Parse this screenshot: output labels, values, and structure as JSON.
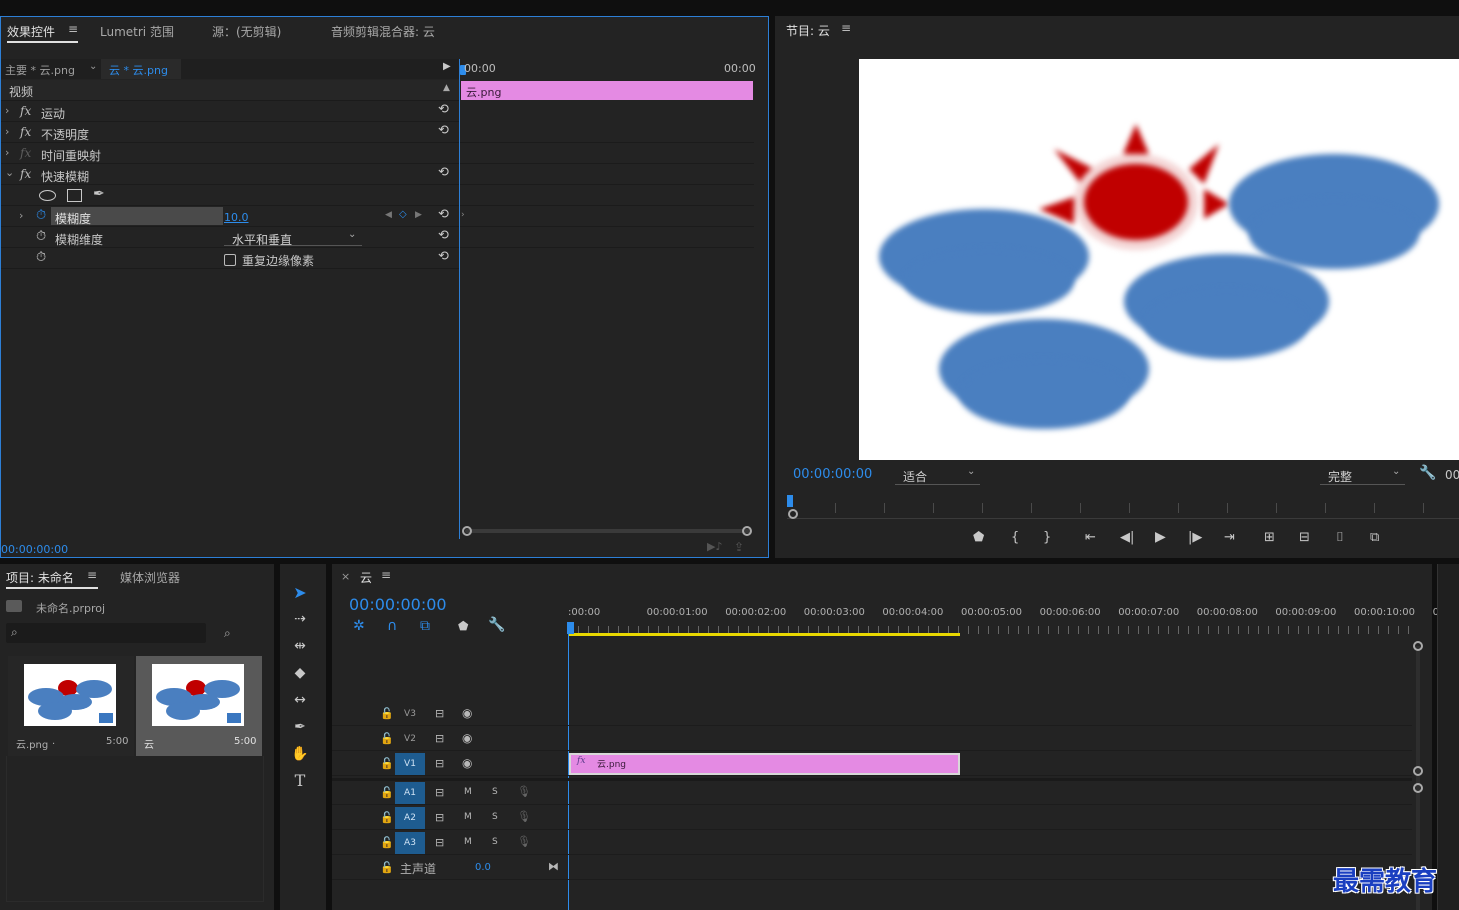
{
  "effect_controls": {
    "tabs": [
      "效果控件",
      "Lumetri 范围",
      "源：(无剪辑)",
      "音频剪辑混合器: 云"
    ],
    "menu_icon": "hamburger-icon",
    "breadcrumb_master": "主要 * 云.png",
    "breadcrumb_clip": "云 * 云.png",
    "section_video": "视频",
    "effects": [
      {
        "name": "运动",
        "fx_enabled": true
      },
      {
        "name": "不透明度",
        "fx_enabled": true
      },
      {
        "name": "时间重映射",
        "fx_enabled": false
      },
      {
        "name": "快速模糊",
        "fx_enabled": true
      }
    ],
    "params": {
      "blurriness_label": "模糊度",
      "blurriness_value": "10.0",
      "dimension_label": "模糊维度",
      "dimension_value": "水平和垂直",
      "repeat_edge_label": "重复边缘像素"
    },
    "timeline_start": "00:00",
    "timeline_end": "00:00",
    "clip_name": "云.png",
    "clip_color": "#e48ae3",
    "current_time": "00:00:00:00"
  },
  "program_monitor": {
    "title": "节目: 云",
    "timecode": "00:00:00:00",
    "fit_value": "适合",
    "quality_value": "完整",
    "right_timecode": "00"
  },
  "project": {
    "tabs": [
      "项目: 未命名",
      "媒体浏览器"
    ],
    "project_file": "未命名.prproj",
    "items": [
      {
        "name": "云.png",
        "extra": ".",
        "duration": "5:00",
        "selected": false
      },
      {
        "name": "云",
        "extra": "",
        "duration": "5:00",
        "selected": true
      }
    ]
  },
  "sequence": {
    "tab_name": "云",
    "timecode": "00:00:00:00",
    "ruler": [
      ":00:00",
      "00:00:01:00",
      "00:00:02:00",
      "00:00:03:00",
      "00:00:04:00",
      "00:00:05:00",
      "00:00:06:00",
      "00:00:07:00",
      "00:00:08:00",
      "00:00:09:00",
      "00:00:10:00",
      "0"
    ],
    "video_tracks": [
      "V3",
      "V2",
      "V1"
    ],
    "audio_tracks": [
      "A1",
      "A2",
      "A3"
    ],
    "mute_label": "M",
    "solo_label": "S",
    "master_label": "主声道",
    "master_value": "0.0",
    "clip_name": "云.png",
    "fx_badge": "fx"
  },
  "watermark": "最需教育"
}
